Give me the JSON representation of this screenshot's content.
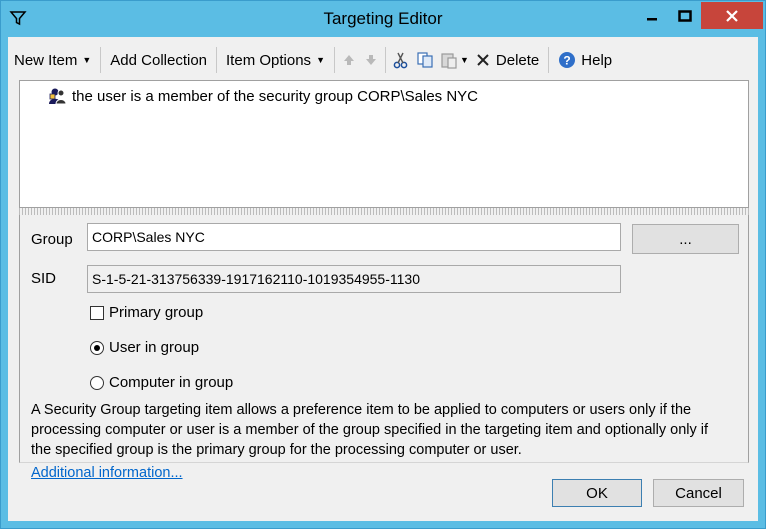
{
  "window": {
    "title": "Targeting Editor"
  },
  "toolbar": {
    "new_item": "New Item",
    "add_collection": "Add Collection",
    "item_options": "Item Options",
    "delete": "Delete",
    "help": "Help"
  },
  "tree": {
    "items": [
      {
        "label": "the user is a member of the security group CORP\\Sales NYC"
      }
    ]
  },
  "form": {
    "group_label": "Group",
    "group_value": "CORP\\Sales NYC",
    "browse_label": "...",
    "sid_label": "SID",
    "sid_value": "S-1-5-21-313756339-1917162110-1019354955-1130",
    "primary_group_label": "Primary group",
    "primary_group_checked": false,
    "user_in_group_label": "User in group",
    "computer_in_group_label": "Computer in group",
    "selected_membership": "user"
  },
  "description": {
    "text": "A Security Group targeting item allows a preference item to be applied to computers or users only if the processing computer or user is a member of the group specified in the targeting item and optionally only if the specified group is the primary group for the processing computer or user.",
    "link": "Additional information..."
  },
  "buttons": {
    "ok": "OK",
    "cancel": "Cancel"
  },
  "colors": {
    "titlebar": "#5bbde4",
    "close_button": "#c7453b",
    "link": "#0066cc"
  }
}
